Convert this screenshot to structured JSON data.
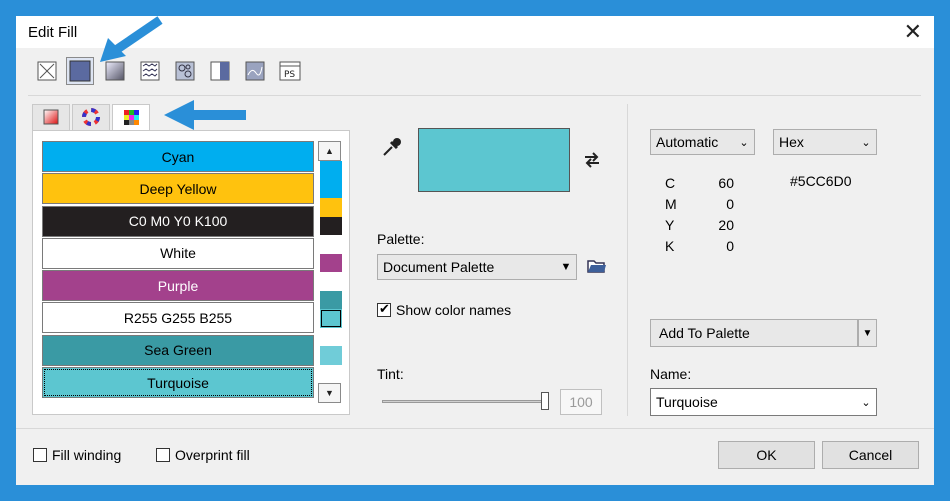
{
  "window": {
    "title": "Edit Fill",
    "close_symbol": "✕"
  },
  "fill_types": [
    "no-fill-icon",
    "uniform-fill-icon",
    "fountain-fill-icon",
    "vector-pattern-icon",
    "bitmap-pattern-icon",
    "two-color-pattern-icon",
    "texture-fill-icon",
    "postscript-fill-icon"
  ],
  "model_tabs": [
    "color-viewers-tab",
    "color-harmonies-tab",
    "color-palettes-tab"
  ],
  "palette_colors": [
    {
      "name": "Cyan",
      "hex": "#00aeef",
      "text_color": "#000000"
    },
    {
      "name": "Deep Yellow",
      "hex": "#ffc20e",
      "text_color": "#000000"
    },
    {
      "name": "C0 M0 Y0 K100",
      "hex": "#231f20",
      "text_color": "#ffffff"
    },
    {
      "name": "White",
      "hex": "#ffffff",
      "text_color": "#000000"
    },
    {
      "name": "Purple",
      "hex": "#a3418c",
      "text_color": "#ffffff"
    },
    {
      "name": "R255 G255 B255",
      "hex": "#ffffff",
      "text_color": "#000000"
    },
    {
      "name": "Sea Green",
      "hex": "#3a9aa4",
      "text_color": "#000000"
    },
    {
      "name": "Turquoise",
      "hex": "#5cc6d0",
      "text_color": "#000000"
    }
  ],
  "mini_swatches": [
    "#00aeef",
    "#00aeef",
    "#ffc20e",
    "#231f20",
    "#ffffff",
    "#a3418c",
    "#ffffff",
    "#3a9aa4",
    "#5cc6d0",
    "#ffffff",
    "#70ccd8",
    "#ffffff"
  ],
  "preview_color": "#5cc6d0",
  "palette": {
    "label": "Palette:",
    "value": "Document Palette",
    "show_names_label": "Show color names",
    "show_names_checked": true
  },
  "tint": {
    "label": "Tint:",
    "value": "100",
    "level_percent": 100
  },
  "color_model": {
    "mode": "Automatic",
    "format": "Hex",
    "hex_value": "#5CC6D0"
  },
  "cmyk": [
    {
      "channel": "C",
      "value": "60"
    },
    {
      "channel": "M",
      "value": "0"
    },
    {
      "channel": "Y",
      "value": "20"
    },
    {
      "channel": "K",
      "value": "0"
    }
  ],
  "add_to_palette": "Add To Palette",
  "name_field": {
    "label": "Name:",
    "value": "Turquoise"
  },
  "footer": {
    "fill_winding": "Fill winding",
    "overprint_fill": "Overprint fill",
    "ok": "OK",
    "cancel": "Cancel"
  },
  "accent": "#2a8fd8"
}
